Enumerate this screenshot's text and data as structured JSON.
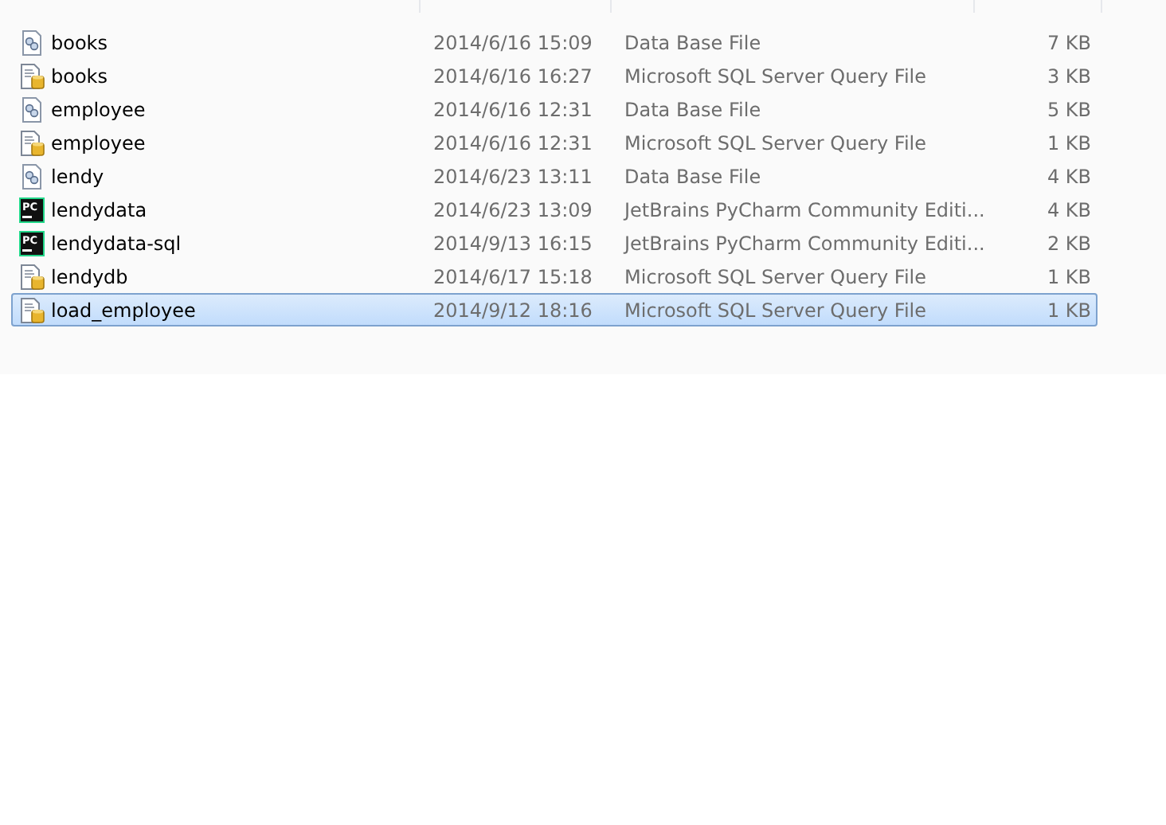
{
  "files": [
    {
      "name": "books",
      "date": "2014/6/16 15:09",
      "type": "Data Base File",
      "size": "7 KB",
      "kind": "db",
      "selected": false
    },
    {
      "name": "books",
      "date": "2014/6/16 16:27",
      "type": "Microsoft SQL Server Query File",
      "size": "3 KB",
      "kind": "sql",
      "selected": false
    },
    {
      "name": "employee",
      "date": "2014/6/16 12:31",
      "type": "Data Base File",
      "size": "5 KB",
      "kind": "db",
      "selected": false
    },
    {
      "name": "employee",
      "date": "2014/6/16 12:31",
      "type": "Microsoft SQL Server Query File",
      "size": "1 KB",
      "kind": "sql",
      "selected": false
    },
    {
      "name": "lendy",
      "date": "2014/6/23 13:11",
      "type": "Data Base File",
      "size": "4 KB",
      "kind": "db",
      "selected": false
    },
    {
      "name": "lendydata",
      "date": "2014/6/23 13:09",
      "type": "JetBrains PyCharm Community Editi...",
      "size": "4 KB",
      "kind": "pycharm",
      "icon_label": "PC",
      "selected": false
    },
    {
      "name": "lendydata-sql",
      "date": "2014/9/13 16:15",
      "type": "JetBrains PyCharm Community Editi...",
      "size": "2 KB",
      "kind": "pycharm",
      "icon_label": "PC",
      "selected": false
    },
    {
      "name": "lendydb",
      "date": "2014/6/17 15:18",
      "type": "Microsoft SQL Server Query File",
      "size": "1 KB",
      "kind": "sql",
      "selected": false
    },
    {
      "name": "load_employee",
      "date": "2014/9/12 18:16",
      "type": "Microsoft SQL Server Query File",
      "size": "1 KB",
      "kind": "sql",
      "selected": true
    }
  ]
}
